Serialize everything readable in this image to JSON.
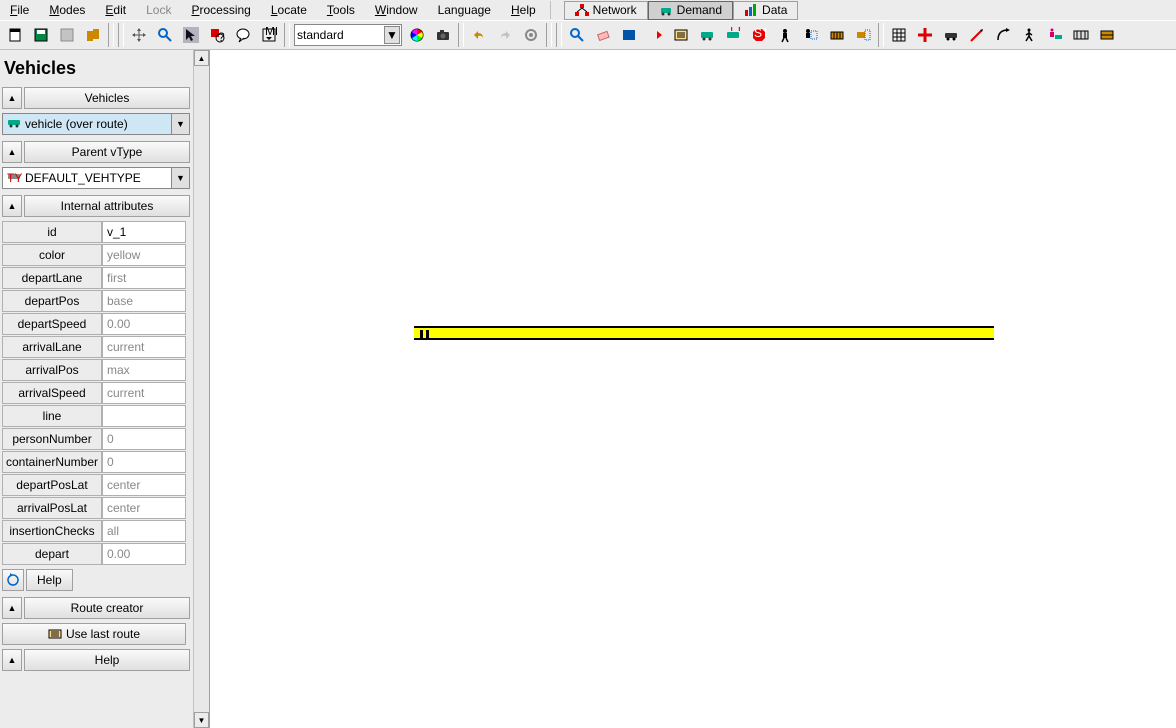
{
  "menu": {
    "file": "File",
    "modes": "Modes",
    "edit": "Edit",
    "lock": "Lock",
    "processing": "Processing",
    "locate": "Locate",
    "tools": "Tools",
    "window": "Window",
    "language": "Language",
    "help": "Help"
  },
  "modeTabs": {
    "network": "Network",
    "demand": "Demand",
    "data": "Data"
  },
  "toolbar": {
    "viewMode": "standard"
  },
  "sidebar": {
    "title": "Vehicles",
    "sections": {
      "vehicles": {
        "label": "Vehicles",
        "combo": "vehicle (over route)"
      },
      "parentVType": {
        "label": "Parent vType",
        "combo": "DEFAULT_VEHTYPE"
      },
      "internalAttributes": {
        "label": "Internal attributes"
      },
      "routeCreator": {
        "label": "Route creator"
      },
      "help": {
        "label": "Help"
      }
    },
    "attributes": [
      {
        "label": "id",
        "value": "v_1",
        "placeholder": false
      },
      {
        "label": "color",
        "value": "yellow",
        "placeholder": true
      },
      {
        "label": "departLane",
        "value": "first",
        "placeholder": true
      },
      {
        "label": "departPos",
        "value": "base",
        "placeholder": true
      },
      {
        "label": "departSpeed",
        "value": "0.00",
        "placeholder": true
      },
      {
        "label": "arrivalLane",
        "value": "current",
        "placeholder": true
      },
      {
        "label": "arrivalPos",
        "value": "max",
        "placeholder": true
      },
      {
        "label": "arrivalSpeed",
        "value": "current",
        "placeholder": true
      },
      {
        "label": "line",
        "value": "",
        "placeholder": false
      },
      {
        "label": "personNumber",
        "value": "0",
        "placeholder": true
      },
      {
        "label": "containerNumber",
        "value": "0",
        "placeholder": true
      },
      {
        "label": "departPosLat",
        "value": "center",
        "placeholder": true
      },
      {
        "label": "arrivalPosLat",
        "value": "center",
        "placeholder": true
      },
      {
        "label": "insertionChecks",
        "value": "all",
        "placeholder": true
      },
      {
        "label": "depart",
        "value": "0.00",
        "placeholder": true
      }
    ],
    "helpButton": "Help",
    "useLastRoute": "Use last route"
  }
}
